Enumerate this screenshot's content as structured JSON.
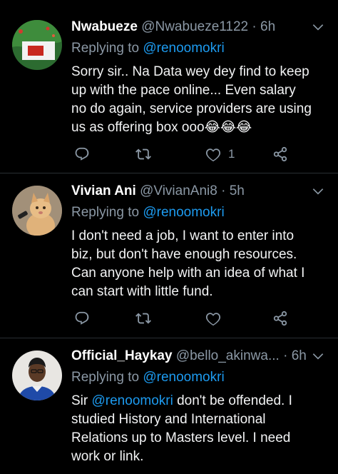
{
  "tweets": [
    {
      "name": "Nwabueze",
      "handle": "@Nwabueze1122",
      "time": "6h",
      "replying_label": "Replying to",
      "replying_to": "@renoomokri",
      "text": "Sorry sir.. Na Data wey dey find to keep up with the pace online... Even salary no do again, service providers are using us as offering box ooo😂😂😂",
      "likes": "1",
      "avatar_icon": "flag-avatar",
      "colors": {
        "green": "#1f7a2a",
        "red": "#c8281f",
        "white": "#ffffff"
      }
    },
    {
      "name": "Vivian Ani",
      "handle": "@VivianAni8",
      "time": "5h",
      "replying_label": "Replying to",
      "replying_to": "@renoomokri",
      "text_lines": [
        "I don't need a job, I want to enter into biz, but don't have enough resources.",
        "Can anyone help with an idea of what I can start with little fund."
      ],
      "likes": "",
      "avatar_icon": "cat-avatar"
    },
    {
      "name": "Official_Haykay",
      "handle": "@bello_akinwa...",
      "time": "6h",
      "replying_label": "Replying to",
      "replying_to": "@renoomokri",
      "text_prefix": "Sir ",
      "text_mention": "@renoomokri",
      "text_rest": " don't be offended. I studied History and International Relations up to Masters level. I need work or link.",
      "avatar_icon": "person-avatar"
    }
  ],
  "separator": "·",
  "theme": {
    "mention": "#1d9bf0",
    "muted": "#8b98a5",
    "background": "#000000"
  }
}
